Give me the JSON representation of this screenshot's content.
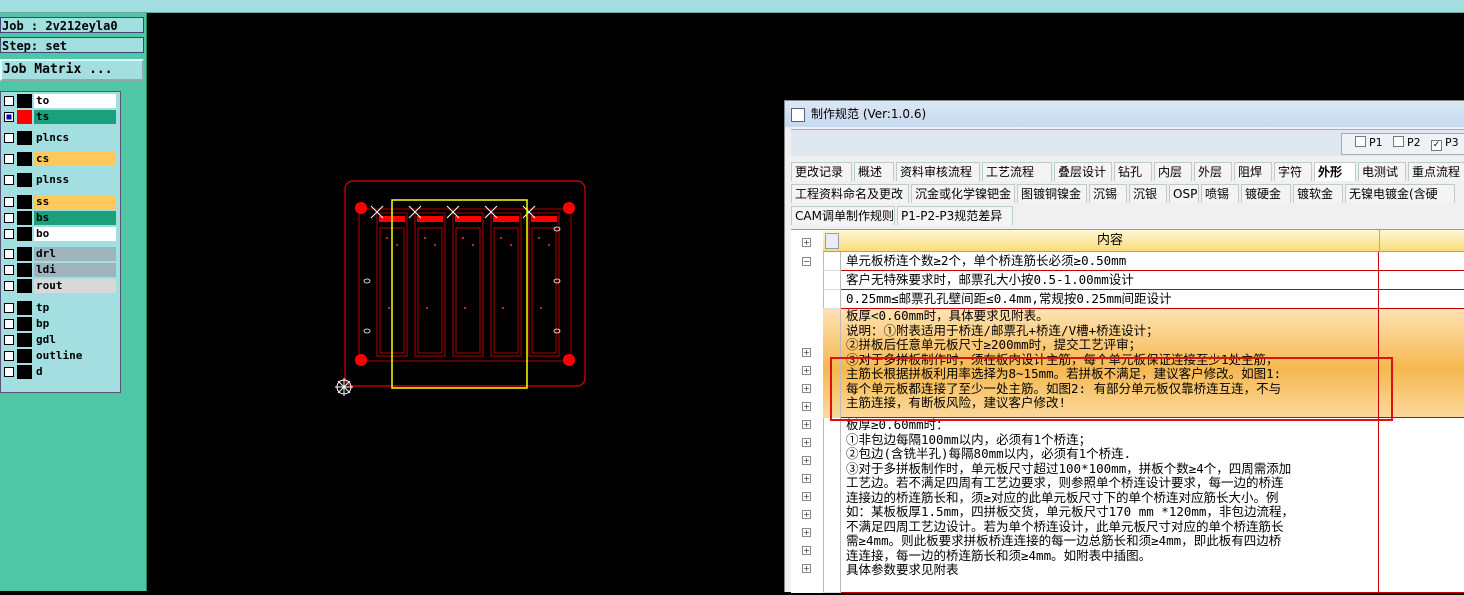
{
  "app": {
    "job_label": "Job : 2v212eyla0",
    "step_label": "Step: set",
    "job_matrix_button": "Job Matrix ..."
  },
  "layers": [
    {
      "name": "to",
      "color": "#ffffff",
      "swatch": "#000000",
      "checked": false
    },
    {
      "name": "ts",
      "color": "#1aa07a",
      "swatch": "#ff0000",
      "checked": true,
      "active": true
    },
    {
      "name": "plncs",
      "color": "#a3dfe0",
      "swatch": "#000000",
      "checked": false
    },
    {
      "name": "cs",
      "color": "#ffc85a",
      "swatch": "#000000",
      "checked": false
    },
    {
      "name": "plnss",
      "color": "#a3dfe0",
      "swatch": "#000000",
      "checked": false
    },
    {
      "name": "ss",
      "color": "#ffc85a",
      "swatch": "#000000",
      "checked": false
    },
    {
      "name": "bs",
      "color": "#1aa07a",
      "swatch": "#000000",
      "checked": false
    },
    {
      "name": "bo",
      "color": "#ffffff",
      "swatch": "#000000",
      "checked": false
    },
    {
      "name": "drl",
      "color": "#9fb3bd",
      "swatch": "#000000",
      "checked": false
    },
    {
      "name": "ldi",
      "color": "#9fb3bd",
      "swatch": "#000000",
      "checked": false
    },
    {
      "name": "rout",
      "color": "#d8d8d8",
      "swatch": "#000000",
      "checked": false
    },
    {
      "name": "tp",
      "color": "#a3dfe0",
      "swatch": "#000000",
      "checked": false
    },
    {
      "name": "bp",
      "color": "#a3dfe0",
      "swatch": "#000000",
      "checked": false
    },
    {
      "name": "gdl",
      "color": "#a3dfe0",
      "swatch": "#000000",
      "checked": false
    },
    {
      "name": "outline",
      "color": "#a3dfe0",
      "swatch": "#000000",
      "checked": false
    },
    {
      "name": "d",
      "color": "#a3dfe0",
      "swatch": "#000000",
      "checked": false
    }
  ],
  "window": {
    "title": "制作规范 (Ver:1.0.6)",
    "p_options": [
      {
        "label": "P1",
        "checked": false
      },
      {
        "label": "P2",
        "checked": false
      },
      {
        "label": "P3",
        "checked": true
      }
    ],
    "tabs_row1": [
      "更改记录",
      "概述",
      "资料审核流程",
      "工艺流程",
      "叠层设计",
      "钻孔",
      "内层",
      "外层",
      "阻焊",
      "字符",
      "外形",
      "电测试",
      "重点流程"
    ],
    "active_tab": "外形",
    "tabs_row2": [
      "工程资料命名及更改",
      "沉金或化学镍钯金",
      "图镀铜镍金",
      "沉锡",
      "沉银",
      "OSP",
      "喷锡",
      "镀硬金",
      "镀软金",
      "无镍电镀金(含硬"
    ],
    "tabs_row3": [
      "CAM调单制作规则",
      "P1-P2-P3规范差异"
    ],
    "column_header": "内容",
    "rows": [
      {
        "lines": [
          "单元板桥连个数≥2个，单个桥连筋长必须≥0.50mm"
        ],
        "highlight": false
      },
      {
        "lines": [
          "客户无特殊要求时，邮票孔大小按0.5-1.00mm设计"
        ],
        "highlight": false
      },
      {
        "lines": [
          "0.25mm≤邮票孔孔壁间距≤0.4mm,常规按0.25mm间距设计"
        ],
        "highlight": false
      },
      {
        "lines": [
          "板厚<0.60mm时，具体要求见附表。",
          "说明：①附表适用于桥连/邮票孔+桥连/V槽+桥连设计；",
          "②拼板后任意单元板尺寸≥200mm时，提交工艺评审；",
          "③对于多拼板制作时，须在板内设计主筋，每个单元板保证连接至少1处主筋，",
          "主筋长根据拼板利用率选择为8~15mm。若拼板不满足，建议客户修改。如图1:",
          "每个单元板都连接了至少一处主筋。如图2: 有部分单元板仅靠桥连互连，不与",
          "主筋连接，有断板风险，建议客户修改!"
        ],
        "highlight": true
      },
      {
        "lines": [
          "板厚≥0.60mm时：",
          "①非包边每隔100mm以内，必须有1个桥连；",
          "②包边(含铣半孔)每隔80mm以内，必须有1个桥连.",
          "③对于多拼板制作时，单元板尺寸超过100*100mm，拼板个数≥4个，四周需添加",
          "工艺边。若不满足四周有工艺边要求，则参照单个桥连设计要求，每一边的桥连",
          "连接边的桥连筋长和，须≥对应的此单元板尺寸下的单个桥连对应筋长大小。例",
          "如：某板板厚1.5mm，四拼板交货，单元板尺寸170 mm *120mm，非包边流程，",
          "不满足四周工艺边设计。若为单个桥连设计，此单元板尺寸对应的单个桥连筋长",
          "需≥4mm。则此板要求拼板桥连连接的每一边总筋长和须≥4mm，即此板有四边桥",
          "连连接，每一边的桥连筋长和须≥4mm。如附表中插图。",
          "具体参数要求见附表"
        ],
        "highlight": false
      }
    ]
  }
}
